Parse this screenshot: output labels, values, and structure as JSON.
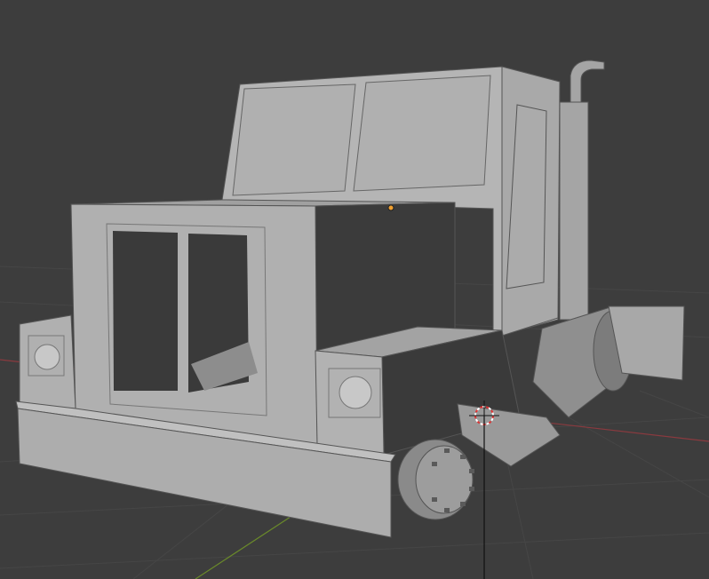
{
  "viewport": {
    "mode": "3D Viewport",
    "background_color": "#3d3d3d",
    "grid_color": "#474747",
    "x_axis_color": "#8a3a3f",
    "y_axis_color": "#6a8a2a",
    "model_color": "#b3b3b3",
    "origin_color": "#f0a030"
  },
  "icons": [
    "3d-cursor-icon",
    "object-origin-icon"
  ]
}
